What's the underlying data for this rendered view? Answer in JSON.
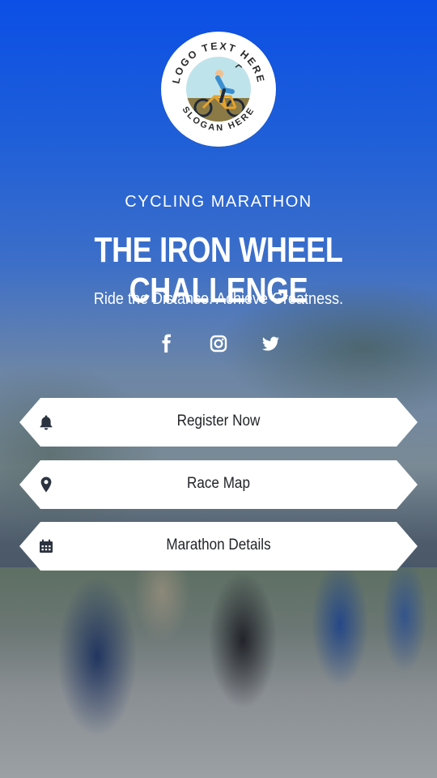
{
  "logo": {
    "top_text": "LOGO TEXT HERE",
    "bottom_text": "SLOGAN HERE",
    "icon": "cyclist-icon"
  },
  "header": {
    "eyebrow": "CYCLING MARATHON",
    "title": "THE IRON WHEEL CHALLENGE",
    "tagline": "Ride the Distance. Achieve Greatness."
  },
  "social": [
    {
      "icon": "facebook-icon"
    },
    {
      "icon": "instagram-icon"
    },
    {
      "icon": "twitter-icon"
    }
  ],
  "buttons": [
    {
      "label": "Register Now",
      "icon": "bell-icon"
    },
    {
      "label": "Race Map",
      "icon": "map-pin-icon"
    },
    {
      "label": "Marathon Details",
      "icon": "calendar-icon"
    }
  ],
  "colors": {
    "accent": "#1b56d6",
    "button_bg": "#ffffff",
    "button_text": "#222428",
    "logo_ring": "#2a2a2a",
    "logo_sky": "#bfe3ea",
    "logo_ground": "#8b7a45"
  }
}
